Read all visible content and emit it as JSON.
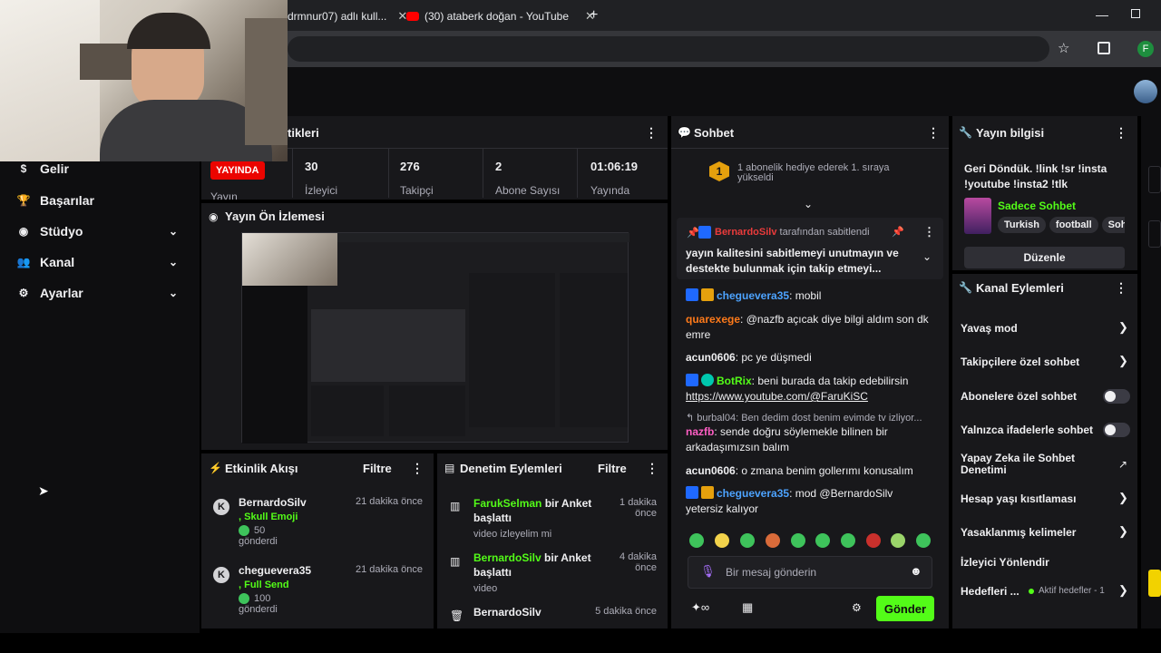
{
  "browser": {
    "tabs": [
      {
        "label": "drmnur07) adlı kull..."
      },
      {
        "label": "(30) ataberk doğan - YouTube"
      }
    ],
    "profile_initial": "F"
  },
  "nav": {
    "items": [
      {
        "label": "Gelir"
      },
      {
        "label": "Başarılar"
      },
      {
        "label": "Stüdyo"
      },
      {
        "label": "Kanal"
      },
      {
        "label": "Ayarlar"
      }
    ]
  },
  "stats": {
    "title": "tikleri",
    "live_badge": "YAYINDA",
    "cut_label": "Yayın",
    "items": [
      {
        "value": "30",
        "label": "İzleyici"
      },
      {
        "value": "276",
        "label": "Takipçi"
      },
      {
        "value": "2",
        "label": "Abone Sayısı"
      },
      {
        "value": "01:06:19",
        "label": "Yayında"
      }
    ]
  },
  "preview": {
    "title": "Yayın Ön İzlemesi"
  },
  "activity": {
    "title": "Etkinlik Akışı",
    "filter": "Filtre",
    "events": [
      {
        "user": "BernardoSilv",
        "item": ", Skull Emoji",
        "amount": "50",
        "sent": "gönderdi",
        "time": "21 dakika önce"
      },
      {
        "user": "cheguevera35",
        "item": ", Full Send",
        "amount": "100",
        "sent": "gönderdi",
        "time": "21 dakika önce"
      }
    ]
  },
  "moderation": {
    "title": "Denetim Eylemleri",
    "filter": "Filtre",
    "items": [
      {
        "user": "FarukSelman",
        "action": " bir Anket başlattı",
        "detail": "video izleyelim mi",
        "time": "1 dakika önce"
      },
      {
        "user": "BernardoSilv",
        "action": " bir Anket başlattı",
        "detail": "video",
        "time": "4 dakika önce"
      },
      {
        "user": "BernardoSilv",
        "action": "",
        "detail": "",
        "time": "5 dakika önce"
      }
    ]
  },
  "chat": {
    "title": "Sohbet",
    "gift_rank": "1",
    "gift_text": "1 abonelik hediye ederek 1. sıraya yükseldi",
    "pinned_by_user": "BernardoSilv",
    "pinned_by_text": " tarafından sabitlendi",
    "pinned_message": "yayın kalitesini sabitlemeyi unutmayın ve destekte bulunmak için takip etmeyi...",
    "messages": [
      {
        "user": "cheguevera35",
        "text": ": mobil"
      },
      {
        "user": "quarexege",
        "text": ": @nazfb açıcak diye bilgi aldım son dk emre"
      },
      {
        "user": "acun0606",
        "text": ": pc ye düşmedi"
      },
      {
        "user": "BotRix",
        "text": ": beni burada da takip edebilirsin",
        "link": "https://www.youtube.com/@FaruKiSC"
      },
      {
        "reply": "burbal04: Ben dedim dost benim evimde tv izliyor..."
      },
      {
        "user": "nazfb",
        "text": ": sende doğru söylemekle bilinen bir arkadaşımızsın balım"
      },
      {
        "user": "acun0606",
        "text": ": o zmana benim gollerımı konusalım"
      },
      {
        "user": "cheguevera35",
        "text": ": mod @BernardoSilv yetersiz kalıyor"
      }
    ],
    "placeholder": "Bir mesaj gönderin",
    "send_label": "Gönder"
  },
  "stream_info": {
    "title": "Yayın bilgisi",
    "stream_title": "Geri Döndük. !link !sr !insta !youtube !insta2 !tlk",
    "category": "Sadece Sohbet",
    "tags": [
      "Turkish",
      "football",
      "Soh"
    ],
    "edit_label": "Düzenle"
  },
  "channel_actions": {
    "title": "Kanal Eylemleri",
    "items": [
      {
        "label": "Yavaş mod"
      },
      {
        "label": "Takipçilere özel sohbet"
      },
      {
        "label": "Abonelere özel sohbet"
      },
      {
        "label": "Yalnızca ifadelerle sohbet"
      },
      {
        "label": "Yapay Zeka ile Sohbet Denetimi"
      },
      {
        "label": "Hesap yaşı kısıtlaması"
      },
      {
        "label": "Yasaklanmış kelimeler"
      },
      {
        "label": "İzleyici Yönlendir"
      },
      {
        "label": "Hedefleri ..."
      }
    ],
    "goals_status": "Aktif hedefler - 1"
  },
  "colors": {
    "accent": "#53fc18",
    "bg": "#0e0e10",
    "panel": "#18181b",
    "live": "#eb0400"
  }
}
